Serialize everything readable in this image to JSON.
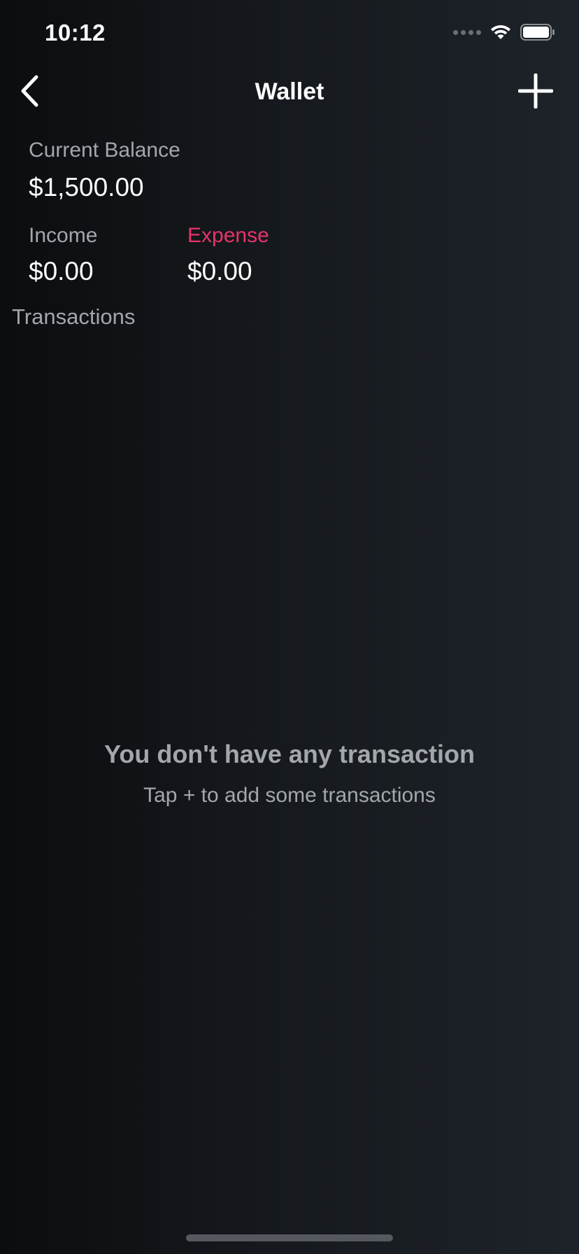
{
  "status_bar": {
    "time": "10:12",
    "icons": [
      "cellular-signal-icon",
      "wifi-icon",
      "battery-icon"
    ]
  },
  "nav": {
    "title": "Wallet",
    "back_icon": "chevron-left-icon",
    "add_icon": "plus-icon"
  },
  "balance": {
    "label": "Current Balance",
    "value": "$1,500.00"
  },
  "income": {
    "label": "Income",
    "value": "$0.00"
  },
  "expense": {
    "label": "Expense",
    "value": "$0.00",
    "color": "#e8336b"
  },
  "transactions": {
    "section_title": "Transactions",
    "empty_title": "You don't have any transaction",
    "empty_subtitle": "Tap + to add some transactions"
  },
  "colors": {
    "background_left": "#0b0d0f",
    "background_right": "#1e232a",
    "secondary_text": "#a3a6ab",
    "accent_expense": "#e8336b"
  }
}
